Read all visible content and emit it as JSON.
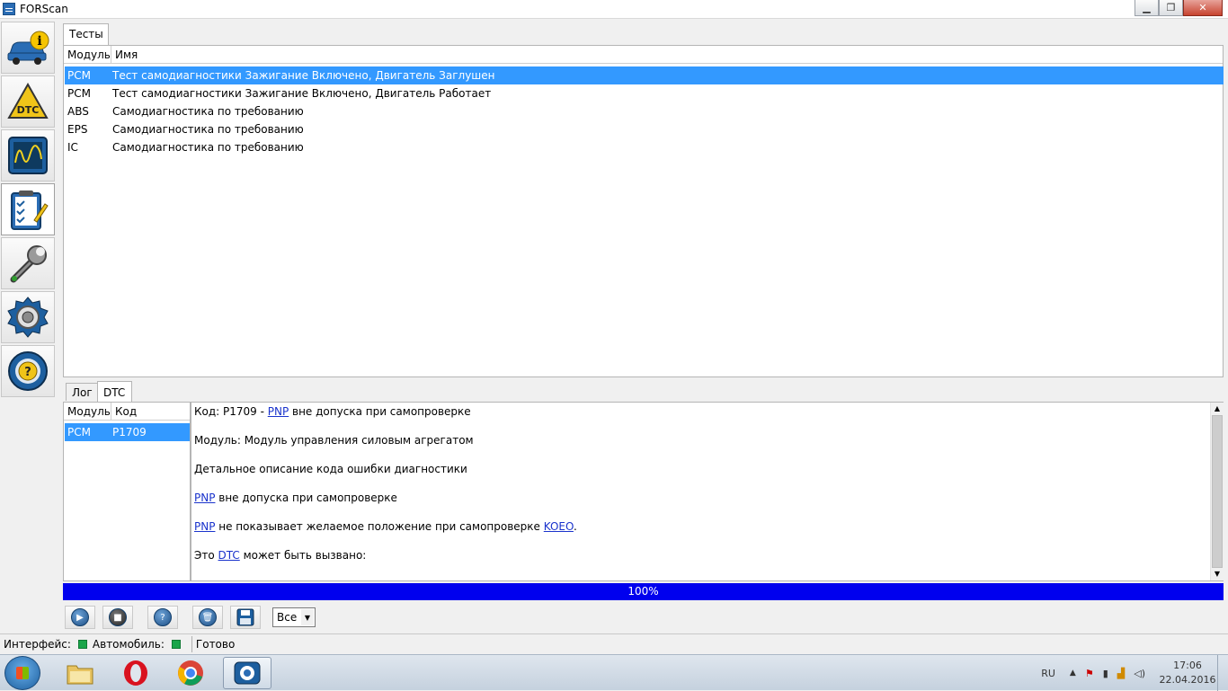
{
  "window": {
    "title": "FORScan"
  },
  "tabs_top": [
    {
      "label": "Тесты"
    }
  ],
  "tests_table": {
    "headers": {
      "module": "Модуль",
      "name": "Имя"
    },
    "rows": [
      {
        "module": "PCM",
        "name": "Тест самодиагностики Зажигание Включено, Двигатель Заглушен",
        "selected": true
      },
      {
        "module": "PCM",
        "name": "Тест самодиагностики Зажигание Включено, Двигатель Работает"
      },
      {
        "module": "ABS",
        "name": "Самодиагностика по требованию"
      },
      {
        "module": "EPS",
        "name": "Самодиагностика по требованию"
      },
      {
        "module": "IC",
        "name": "Самодиагностика по требованию"
      }
    ]
  },
  "tabs_bottom": [
    {
      "label": "Лог"
    },
    {
      "label": "DTC",
      "active": true
    }
  ],
  "dtc_table": {
    "headers": {
      "module": "Модуль",
      "code": "Код"
    },
    "rows": [
      {
        "module": "PCM",
        "code": "P1709",
        "selected": true
      }
    ]
  },
  "dtc_detail": {
    "line1": {
      "prefix": "Код: P1709 - ",
      "link": "PNP",
      "suffix": " вне допуска при самопроверке"
    },
    "line2": "Модуль: Модуль управления силовым агрегатом",
    "line3": "Детальное описание кода ошибки диагностики",
    "line4": {
      "link": "PNP",
      "suffix": " вне допуска при самопроверке"
    },
    "line5": {
      "link": "PNP",
      "middle": " не показывает желаемое положение при самопроверке ",
      "link2": "KOEO",
      "suffix": "."
    },
    "line6": {
      "prefix": "Это ",
      "link": "DTC",
      "suffix": " может быть вызвано:"
    }
  },
  "progress": {
    "text": "100%",
    "value_percent": 100
  },
  "toolbar": {
    "filter_value": "Все"
  },
  "status": {
    "interface_label": "Интерфейс:",
    "vehicle_label": "Автомобиль:",
    "state": "Готово",
    "ok_color": "#1aa54a"
  },
  "taskbar": {
    "lang": "RU",
    "time": "17:06",
    "date": "22.04.2016"
  }
}
